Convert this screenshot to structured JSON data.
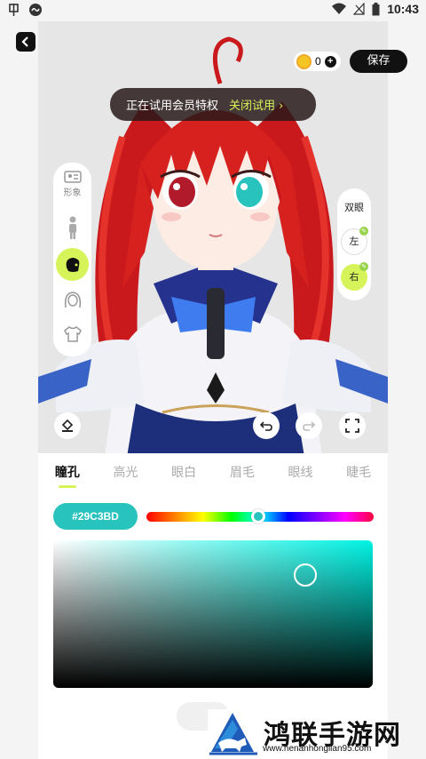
{
  "status_bar": {
    "time": "10:43",
    "icons": [
      "app-icon-1",
      "app-icon-2",
      "wifi-icon",
      "signal-off-icon",
      "battery-icon"
    ]
  },
  "top": {
    "coins": "0",
    "save_label": "保存"
  },
  "trial": {
    "message": "正在试用会员特权",
    "close_label": "关闭试用",
    "chevron": "›"
  },
  "left_tools": {
    "items": [
      {
        "name": "shape",
        "label": "形象",
        "icon": "profile-card-icon"
      },
      {
        "name": "body",
        "label": "",
        "icon": "person-icon"
      },
      {
        "name": "face",
        "label": "",
        "icon": "face-icon"
      },
      {
        "name": "hair",
        "label": "",
        "icon": "hair-icon"
      },
      {
        "name": "clothes",
        "label": "",
        "icon": "shirt-icon"
      }
    ],
    "active_index": 2
  },
  "eye_selector": {
    "title": "双眼",
    "left_label": "左",
    "right_label": "右",
    "active": "右"
  },
  "panel": {
    "tabs": [
      "瞳孔",
      "高光",
      "眼白",
      "眉毛",
      "眼线",
      "睫毛"
    ],
    "active_tab": 0,
    "hex_value": "#29C3BD",
    "selected_color": "#29C3BD",
    "accent_color": "#D7F35A"
  },
  "watermark": {
    "title": "鸿联手游网",
    "url": "www.henanhonglian95.com"
  }
}
